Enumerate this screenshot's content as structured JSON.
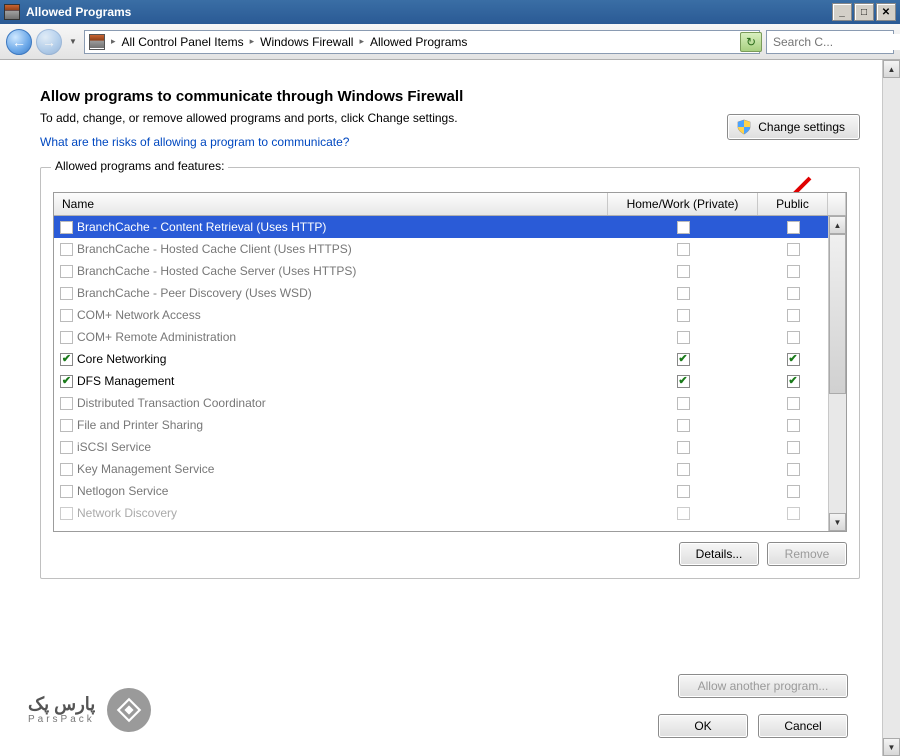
{
  "window": {
    "title": "Allowed Programs"
  },
  "breadcrumb": {
    "items": [
      "All Control Panel Items",
      "Windows Firewall",
      "Allowed Programs"
    ]
  },
  "search": {
    "placeholder": "Search C..."
  },
  "page": {
    "heading": "Allow programs to communicate through Windows Firewall",
    "subtitle": "To add, change, or remove allowed programs and ports, click Change settings.",
    "risks_link": "What are the risks of allowing a program to communicate?",
    "change_settings": "Change settings"
  },
  "group": {
    "legend": "Allowed programs and features:",
    "columns": {
      "name": "Name",
      "home": "Home/Work (Private)",
      "public": "Public"
    },
    "details": "Details...",
    "remove": "Remove"
  },
  "programs": [
    {
      "name": "BranchCache - Content Retrieval (Uses HTTP)",
      "checked": false,
      "home": false,
      "public": false,
      "disabled": true,
      "selected": true
    },
    {
      "name": "BranchCache - Hosted Cache Client (Uses HTTPS)",
      "checked": false,
      "home": false,
      "public": false,
      "disabled": true
    },
    {
      "name": "BranchCache - Hosted Cache Server (Uses HTTPS)",
      "checked": false,
      "home": false,
      "public": false,
      "disabled": true
    },
    {
      "name": "BranchCache - Peer Discovery (Uses WSD)",
      "checked": false,
      "home": false,
      "public": false,
      "disabled": true
    },
    {
      "name": "COM+ Network Access",
      "checked": false,
      "home": false,
      "public": false,
      "disabled": true
    },
    {
      "name": "COM+ Remote Administration",
      "checked": false,
      "home": false,
      "public": false,
      "disabled": true
    },
    {
      "name": "Core Networking",
      "checked": true,
      "home": true,
      "public": true,
      "disabled": false
    },
    {
      "name": "DFS Management",
      "checked": true,
      "home": true,
      "public": true,
      "disabled": false
    },
    {
      "name": "Distributed Transaction Coordinator",
      "checked": false,
      "home": false,
      "public": false,
      "disabled": true
    },
    {
      "name": "File and Printer Sharing",
      "checked": false,
      "home": false,
      "public": false,
      "disabled": true
    },
    {
      "name": "iSCSI Service",
      "checked": false,
      "home": false,
      "public": false,
      "disabled": true
    },
    {
      "name": "Key Management Service",
      "checked": false,
      "home": false,
      "public": false,
      "disabled": true
    },
    {
      "name": "Netlogon Service",
      "checked": false,
      "home": false,
      "public": false,
      "disabled": true
    },
    {
      "name": "Network Discovery",
      "checked": false,
      "home": false,
      "public": false,
      "disabled": true,
      "cut": true
    }
  ],
  "buttons": {
    "allow_another": "Allow another program...",
    "ok": "OK",
    "cancel": "Cancel"
  },
  "watermark": {
    "ar": "پارس پک",
    "en": "ParsPack"
  }
}
